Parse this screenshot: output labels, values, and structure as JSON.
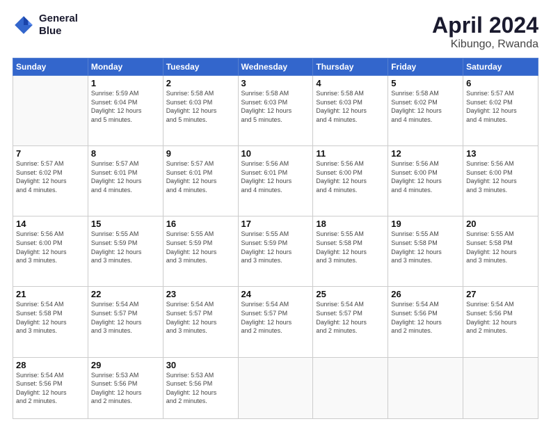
{
  "header": {
    "logo": {
      "line1": "General",
      "line2": "Blue"
    },
    "title": "April 2024",
    "subtitle": "Kibungo, Rwanda"
  },
  "calendar": {
    "days_of_week": [
      "Sunday",
      "Monday",
      "Tuesday",
      "Wednesday",
      "Thursday",
      "Friday",
      "Saturday"
    ],
    "weeks": [
      [
        {
          "num": "",
          "info": ""
        },
        {
          "num": "1",
          "info": "Sunrise: 5:59 AM\nSunset: 6:04 PM\nDaylight: 12 hours\nand 5 minutes."
        },
        {
          "num": "2",
          "info": "Sunrise: 5:58 AM\nSunset: 6:03 PM\nDaylight: 12 hours\nand 5 minutes."
        },
        {
          "num": "3",
          "info": "Sunrise: 5:58 AM\nSunset: 6:03 PM\nDaylight: 12 hours\nand 5 minutes."
        },
        {
          "num": "4",
          "info": "Sunrise: 5:58 AM\nSunset: 6:03 PM\nDaylight: 12 hours\nand 4 minutes."
        },
        {
          "num": "5",
          "info": "Sunrise: 5:58 AM\nSunset: 6:02 PM\nDaylight: 12 hours\nand 4 minutes."
        },
        {
          "num": "6",
          "info": "Sunrise: 5:57 AM\nSunset: 6:02 PM\nDaylight: 12 hours\nand 4 minutes."
        }
      ],
      [
        {
          "num": "7",
          "info": "Sunrise: 5:57 AM\nSunset: 6:02 PM\nDaylight: 12 hours\nand 4 minutes."
        },
        {
          "num": "8",
          "info": "Sunrise: 5:57 AM\nSunset: 6:01 PM\nDaylight: 12 hours\nand 4 minutes."
        },
        {
          "num": "9",
          "info": "Sunrise: 5:57 AM\nSunset: 6:01 PM\nDaylight: 12 hours\nand 4 minutes."
        },
        {
          "num": "10",
          "info": "Sunrise: 5:56 AM\nSunset: 6:01 PM\nDaylight: 12 hours\nand 4 minutes."
        },
        {
          "num": "11",
          "info": "Sunrise: 5:56 AM\nSunset: 6:00 PM\nDaylight: 12 hours\nand 4 minutes."
        },
        {
          "num": "12",
          "info": "Sunrise: 5:56 AM\nSunset: 6:00 PM\nDaylight: 12 hours\nand 4 minutes."
        },
        {
          "num": "13",
          "info": "Sunrise: 5:56 AM\nSunset: 6:00 PM\nDaylight: 12 hours\nand 3 minutes."
        }
      ],
      [
        {
          "num": "14",
          "info": "Sunrise: 5:56 AM\nSunset: 6:00 PM\nDaylight: 12 hours\nand 3 minutes."
        },
        {
          "num": "15",
          "info": "Sunrise: 5:55 AM\nSunset: 5:59 PM\nDaylight: 12 hours\nand 3 minutes."
        },
        {
          "num": "16",
          "info": "Sunrise: 5:55 AM\nSunset: 5:59 PM\nDaylight: 12 hours\nand 3 minutes."
        },
        {
          "num": "17",
          "info": "Sunrise: 5:55 AM\nSunset: 5:59 PM\nDaylight: 12 hours\nand 3 minutes."
        },
        {
          "num": "18",
          "info": "Sunrise: 5:55 AM\nSunset: 5:58 PM\nDaylight: 12 hours\nand 3 minutes."
        },
        {
          "num": "19",
          "info": "Sunrise: 5:55 AM\nSunset: 5:58 PM\nDaylight: 12 hours\nand 3 minutes."
        },
        {
          "num": "20",
          "info": "Sunrise: 5:55 AM\nSunset: 5:58 PM\nDaylight: 12 hours\nand 3 minutes."
        }
      ],
      [
        {
          "num": "21",
          "info": "Sunrise: 5:54 AM\nSunset: 5:58 PM\nDaylight: 12 hours\nand 3 minutes."
        },
        {
          "num": "22",
          "info": "Sunrise: 5:54 AM\nSunset: 5:57 PM\nDaylight: 12 hours\nand 3 minutes."
        },
        {
          "num": "23",
          "info": "Sunrise: 5:54 AM\nSunset: 5:57 PM\nDaylight: 12 hours\nand 3 minutes."
        },
        {
          "num": "24",
          "info": "Sunrise: 5:54 AM\nSunset: 5:57 PM\nDaylight: 12 hours\nand 2 minutes."
        },
        {
          "num": "25",
          "info": "Sunrise: 5:54 AM\nSunset: 5:57 PM\nDaylight: 12 hours\nand 2 minutes."
        },
        {
          "num": "26",
          "info": "Sunrise: 5:54 AM\nSunset: 5:56 PM\nDaylight: 12 hours\nand 2 minutes."
        },
        {
          "num": "27",
          "info": "Sunrise: 5:54 AM\nSunset: 5:56 PM\nDaylight: 12 hours\nand 2 minutes."
        }
      ],
      [
        {
          "num": "28",
          "info": "Sunrise: 5:54 AM\nSunset: 5:56 PM\nDaylight: 12 hours\nand 2 minutes."
        },
        {
          "num": "29",
          "info": "Sunrise: 5:53 AM\nSunset: 5:56 PM\nDaylight: 12 hours\nand 2 minutes."
        },
        {
          "num": "30",
          "info": "Sunrise: 5:53 AM\nSunset: 5:56 PM\nDaylight: 12 hours\nand 2 minutes."
        },
        {
          "num": "",
          "info": ""
        },
        {
          "num": "",
          "info": ""
        },
        {
          "num": "",
          "info": ""
        },
        {
          "num": "",
          "info": ""
        }
      ]
    ]
  }
}
